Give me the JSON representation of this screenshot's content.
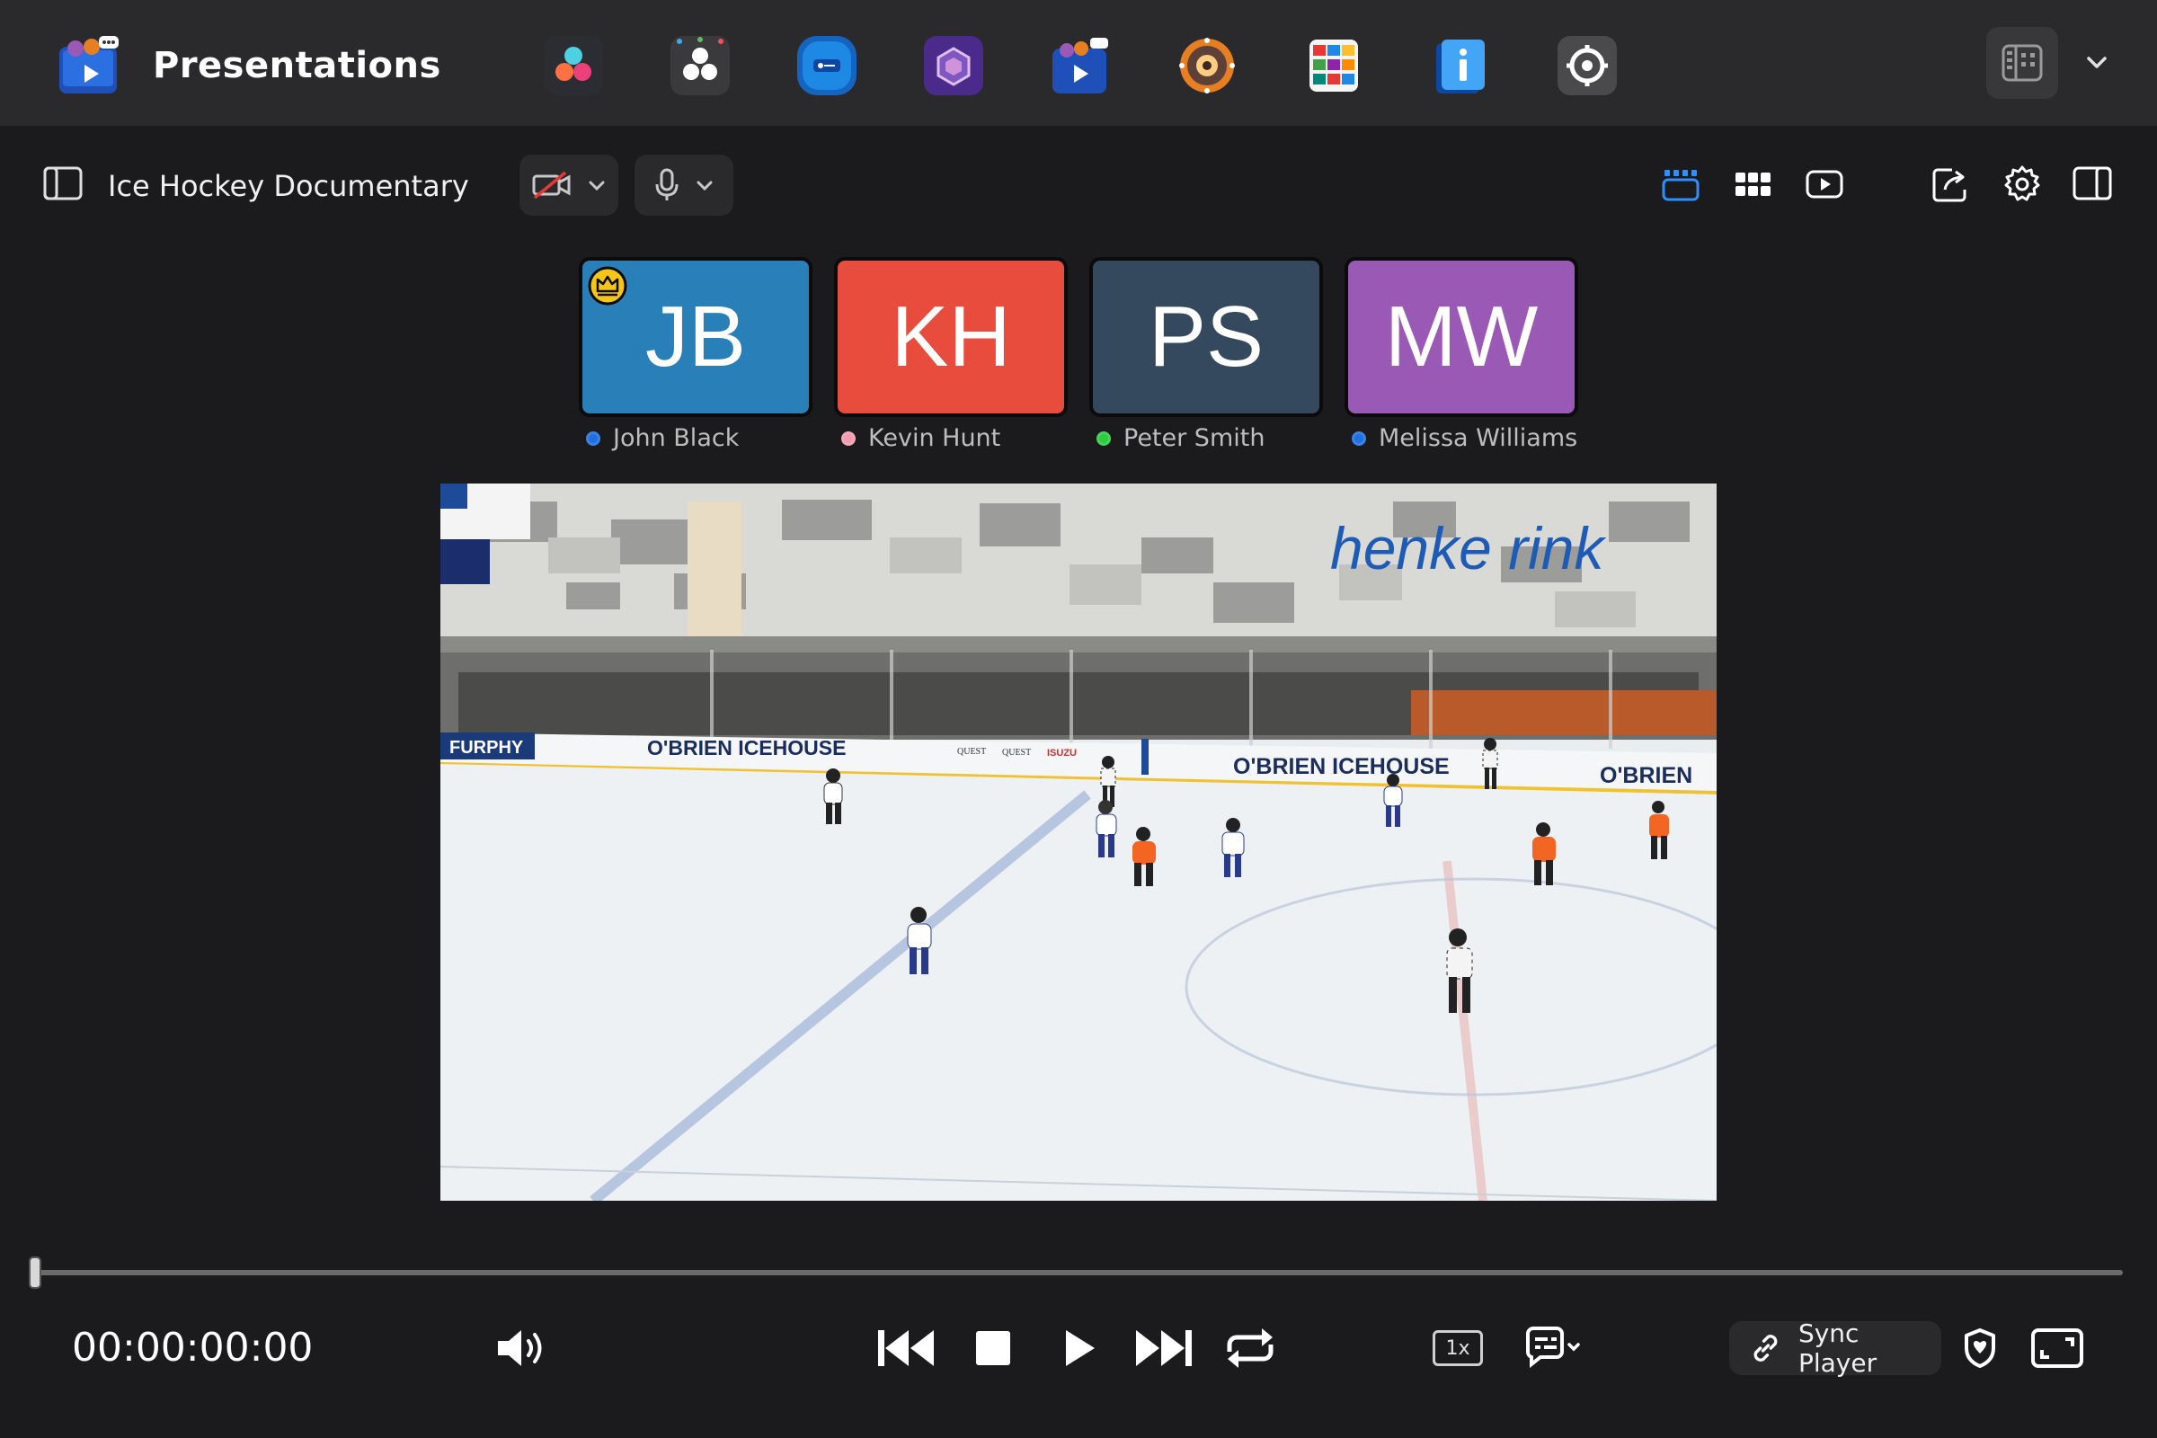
{
  "app": {
    "title": "Presentations"
  },
  "dock": {
    "apps": [
      {
        "name": "davinci-resolve-icon",
        "bg": "#2b2d33"
      },
      {
        "name": "davinci-panel-icon",
        "bg": "#3a3a3d"
      },
      {
        "name": "key-app-icon",
        "bg": "#1565c0"
      },
      {
        "name": "hex-app-icon",
        "bg": "#5e35b1"
      },
      {
        "name": "presentations-app-icon",
        "bg": "#2d2d30"
      },
      {
        "name": "speaker-app-icon",
        "bg": "#5a4128"
      },
      {
        "name": "tiles-app-icon",
        "bg": "#3c3c3c"
      },
      {
        "name": "info-app-icon",
        "bg": "#1e88e5"
      },
      {
        "name": "settings-app-icon",
        "bg": "#4a4a4d"
      }
    ]
  },
  "toolbar": {
    "doc_title": "Ice Hockey Documentary"
  },
  "participants": [
    {
      "initials": "JB",
      "name": "John Black",
      "color": "#2980b9",
      "status": "#1e6fe0",
      "host": true
    },
    {
      "initials": "KH",
      "name": "Kevin Hunt",
      "color": "#e74c3c",
      "status": "#f29bb0",
      "host": false
    },
    {
      "initials": "PS",
      "name": "Peter Smith",
      "color": "#34495e",
      "status": "#2ecc40",
      "host": false
    },
    {
      "initials": "MW",
      "name": "Melissa Williams",
      "color": "#9b59b6",
      "status": "#1e6fe0",
      "host": false
    }
  ],
  "video": {
    "banner": "henke rink",
    "boards": [
      "FURPHY",
      "O'BRIEN ICEHOUSE",
      "QUEST",
      "QUEST",
      "ISUZU",
      "O'BRIEN ICEHOUSE",
      "O'BRIEN"
    ]
  },
  "playback": {
    "timecode": "00:00:00:00",
    "progress": 0,
    "speed": "1x",
    "sync_label": "Sync Player"
  },
  "colors": {
    "accent": "#2f8fff",
    "bar_bg": "#2a2a2d",
    "page_bg": "#1b1b1d"
  }
}
